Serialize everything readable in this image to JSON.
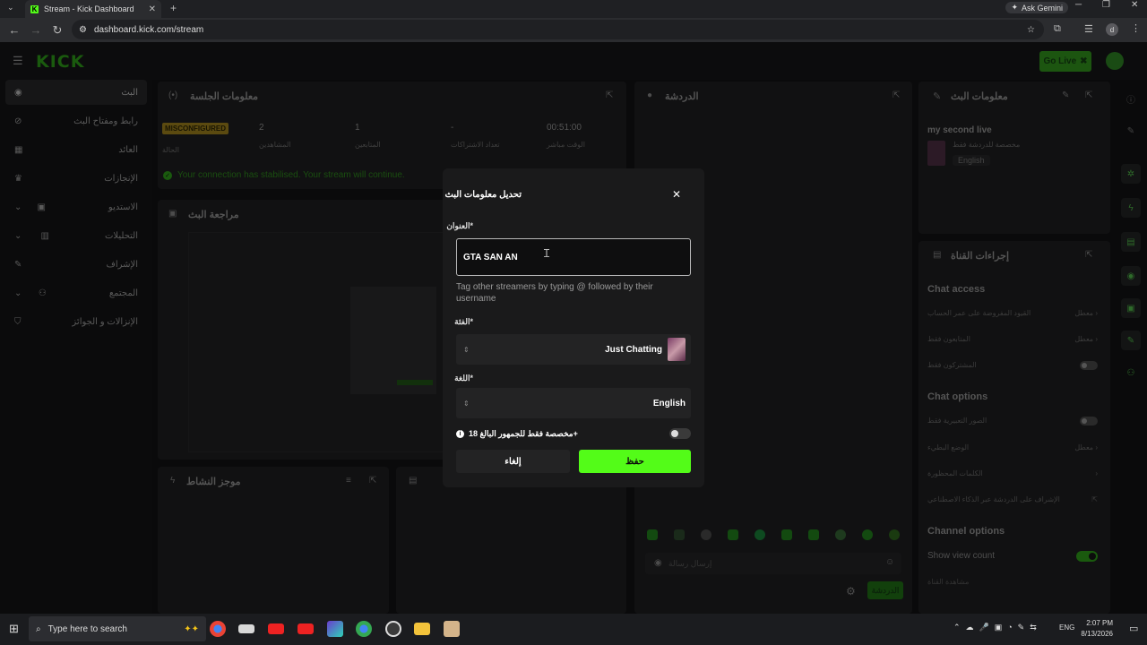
{
  "browser": {
    "tab_title": "Stream - Kick Dashboard",
    "url": "dashboard.kick.com/stream",
    "ask_gemini": "Ask Gemini",
    "profile_initial": "d"
  },
  "app": {
    "logo": "KICK",
    "go_live": "Go Live"
  },
  "sidebar": {
    "items": [
      {
        "label": "البث",
        "icon": "broadcast-icon"
      },
      {
        "label": "رابط ومفتاح البث",
        "icon": "link-icon"
      },
      {
        "label": "العائد",
        "icon": "revenue-icon"
      },
      {
        "label": "الإنجازات",
        "icon": "trophy-icon"
      },
      {
        "label": "الاستديو",
        "icon": "studio-icon"
      },
      {
        "label": "التحليلات",
        "icon": "analytics-icon"
      },
      {
        "label": "الإشراف",
        "icon": "moderation-icon"
      },
      {
        "label": "المجتمع",
        "icon": "community-icon"
      },
      {
        "label": "الإنزالات و الجوائز",
        "icon": "drops-icon"
      }
    ]
  },
  "session_panel": {
    "title": "معلومات الجلسة",
    "status_badge": "MISCONFIGURED",
    "stats": [
      {
        "value": "",
        "label": "الحالة"
      },
      {
        "value": "2",
        "label": "المشاهدين"
      },
      {
        "value": "1",
        "label": "المتابعين"
      },
      {
        "value": "-",
        "label": "تعداد الاشتراكات"
      },
      {
        "value": "00:51:00",
        "label": "الوقت مباشر"
      }
    ],
    "notice": "Your connection has stabilised. Your stream will continue."
  },
  "preview_panel": {
    "title": "مراجعة البث"
  },
  "activity_panel": {
    "title": "موجز النشاط"
  },
  "chat_panel": {
    "title": "الدردشة",
    "send_placeholder": "إرسال رسالة",
    "chat_button": "الدردشة"
  },
  "stream_info": {
    "title": "معلومات البث",
    "stream_name": "my second live",
    "audience": "مخصصة للدردشة فقط",
    "language": "English"
  },
  "channel_actions": {
    "title": "إجراءات القناة",
    "chat_access_heading": "Chat access",
    "chat_access_rows": [
      {
        "label": "القيود المفروضة على عمر الحساب",
        "value": "معطل"
      },
      {
        "label": "المتابعون فقط",
        "value": "معطل"
      },
      {
        "label": "المشتركون فقط",
        "value": ""
      }
    ],
    "chat_options_heading": "Chat options",
    "chat_options_rows": [
      {
        "label": "الصور التعبيرية فقط",
        "value": ""
      },
      {
        "label": "الوضع البطيء",
        "value": "معطل"
      },
      {
        "label": "الكلمات المحظورة",
        "value": ""
      },
      {
        "label": "الإشراف على الدردشة عبر الذكاء الاصطناعي",
        "value": ""
      }
    ],
    "channel_options_heading": "Channel options",
    "show_view_count": "Show view count",
    "last_row": "مشاهدة القناة"
  },
  "modal": {
    "title": "تحديل معلومات البث",
    "title_label": "العنوان*",
    "title_value": "GTA SAN AN",
    "title_hint": "Tag other streamers by typing @ followed by their username",
    "category_label": "الفئة*",
    "category_value": "Just Chatting",
    "language_label": "اللغة*",
    "language_value": "English",
    "mature_label": "مخصصة فقط للجمهور البالغ 18+",
    "mature_on": false,
    "cancel": "إلغاء",
    "save": "حفظ"
  },
  "taskbar": {
    "search_placeholder": "Type here to search",
    "lang": "ENG",
    "time": "2:07 PM",
    "date": "8/13/2026"
  },
  "colors": {
    "kick_green": "#53fc18",
    "modal_bg": "#1a1a1b"
  }
}
